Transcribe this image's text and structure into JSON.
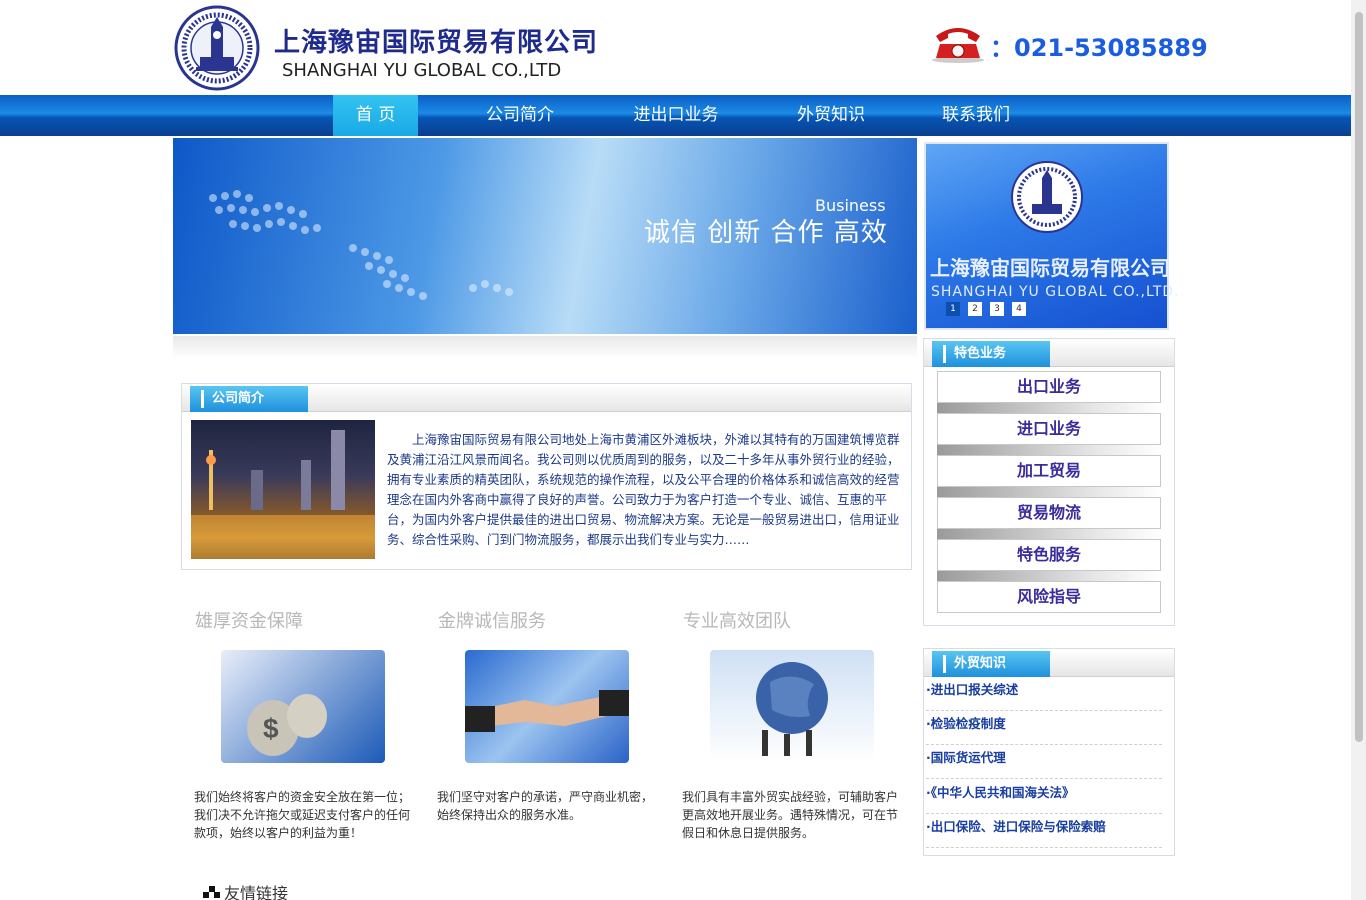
{
  "header": {
    "company_cn": "上海豫宙国际贸易有限公司",
    "company_en": "SHANGHAI YU GLOBAL CO.,LTD",
    "phone": "：021-53085889"
  },
  "nav": {
    "items": [
      {
        "label": "首 页"
      },
      {
        "label": "公司简介"
      },
      {
        "label": "进出口业务"
      },
      {
        "label": "外贸知识"
      },
      {
        "label": "联系我们"
      }
    ]
  },
  "banner": {
    "en": "Business",
    "cn": "诚信  创新  合作  高效"
  },
  "slide": {
    "cn": "上海豫宙国际贸易有限公司",
    "en": "SHANGHAI YU GLOBAL CO.,LTD.",
    "dots": [
      "1",
      "2",
      "3",
      "4"
    ]
  },
  "about": {
    "title": "公司简介",
    "text": "上海豫宙国际贸易有限公司地处上海市黄浦区外滩板块，外滩以其特有的万国建筑博览群及黄浦江沿江风景而闻名。我公司则以优质周到的服务，以及二十多年从事外贸行业的经验，拥有专业素质的精英团队，系统规范的操作流程，以及公平合理的价格体系和诚信高效的经营理念在国内外客商中赢得了良好的声誉。公司致力于为客户打造一个专业、诚信、互惠的平台，为国内外客户提供最佳的进出口贸易、物流解决方案。无论是一般贸易进出口，信用证业务、综合性采购、门到门物流服务，都展示出我们专业与实力……"
  },
  "features": [
    {
      "title": "雄厚资金保障",
      "text": "我们始终将客户的资金安全放在第一位；我们决不允许拖欠或延迟支付客户的任何款项，始终以客户的利益为重！"
    },
    {
      "title": "金牌诚信服务",
      "text": "我们坚守对客户的承诺，严守商业机密，始终保持出众的服务水准。"
    },
    {
      "title": "专业高效团队",
      "text": "我们具有丰富外贸实战经验，可辅助客户更高效地开展业务。遇特殊情况，可在节假日和休息日提供服务。"
    }
  ],
  "services": {
    "title": "特色业务",
    "items": [
      "出口业务",
      "进口业务",
      "加工贸易",
      "贸易物流",
      "特色服务",
      "风险指导"
    ]
  },
  "knowledge": {
    "title": "外贸知识",
    "items": [
      "·进出口报关综述",
      "·检验检疫制度",
      "·国际货运代理",
      "·《中华人民共和国海关法》",
      "·出口保险、进口保险与保险索赔"
    ]
  },
  "links": {
    "title": "友情链接"
  },
  "colors": {
    "nav_blue": "#0a5fc4",
    "nav_active": "#1aa8e6",
    "brand_dark": "#1e2a8c",
    "phone_blue": "#1a5de0",
    "service_text": "#3a2c9c",
    "link_blue": "#1a3ea0"
  }
}
